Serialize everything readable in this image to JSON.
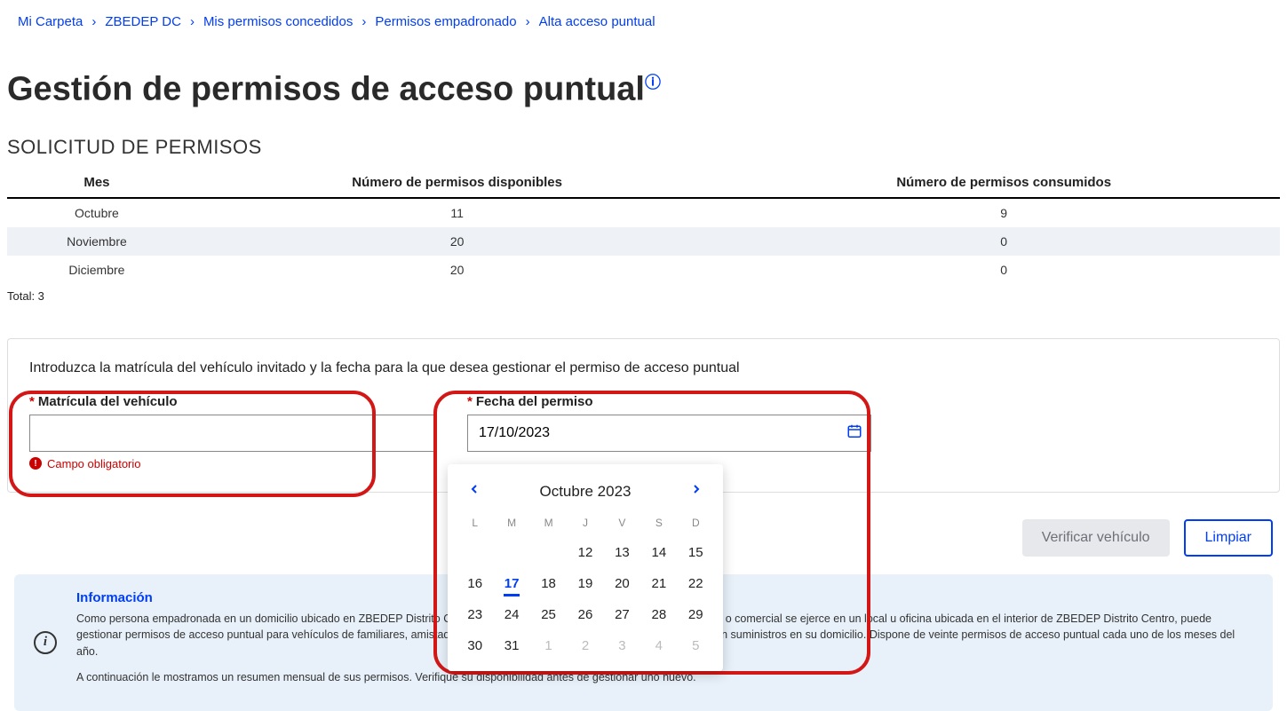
{
  "breadcrumb": [
    "Mi Carpeta",
    "ZBEDEP DC",
    "Mis permisos concedidos",
    "Permisos empadronado",
    "Alta acceso puntual"
  ],
  "title": "Gestión de permisos de acceso puntual",
  "section": "SOLICITUD DE PERMISOS",
  "table": {
    "headers": [
      "Mes",
      "Número de permisos disponibles",
      "Número de permisos consumidos"
    ],
    "rows": [
      {
        "mes": "Octubre",
        "disp": "11",
        "cons": "9"
      },
      {
        "mes": "Noviembre",
        "disp": "20",
        "cons": "0"
      },
      {
        "mes": "Diciembre",
        "disp": "20",
        "cons": "0"
      }
    ],
    "total": "Total: 3"
  },
  "form": {
    "intro": "Introduzca la matrícula del vehículo invitado y la fecha para la que desea gestionar el permiso de acceso puntual",
    "matricula_label": "Matrícula del vehículo",
    "matricula_value": "",
    "matricula_error": "Campo obligatorio",
    "fecha_label": "Fecha del permiso",
    "fecha_value": "17/10/2023"
  },
  "buttons": {
    "verify": "Verificar vehículo",
    "clear": "Limpiar"
  },
  "info": {
    "title": "Información",
    "p1": "Como persona empadronada en un domicilio ubicado en ZBEDEP Distrito Centro, o como persona física cuya actividad profesional o comercial se ejerce en un local u oficina ubicada en el interior de ZBEDEP Distrito Centro, puede gestionar permisos de acceso puntual para vehículos de familiares, amistades, profesionales que presten un servicio, o que realicen suministros en su domicilio. Dispone de veinte permisos de acceso puntual cada uno de los meses del año.",
    "p2": "A continuación le mostramos un resumen mensual de sus permisos. Verifique su disponibilidad antes de gestionar uno nuevo."
  },
  "calendar": {
    "title": "Octubre 2023",
    "dow": [
      "L",
      "M",
      "M",
      "J",
      "V",
      "S",
      "D"
    ],
    "cells": [
      {
        "n": "",
        "cls": ""
      },
      {
        "n": "",
        "cls": ""
      },
      {
        "n": "",
        "cls": ""
      },
      {
        "n": "12",
        "cls": ""
      },
      {
        "n": "13",
        "cls": ""
      },
      {
        "n": "14",
        "cls": ""
      },
      {
        "n": "15",
        "cls": ""
      },
      {
        "n": "16",
        "cls": ""
      },
      {
        "n": "17",
        "cls": "sel"
      },
      {
        "n": "18",
        "cls": ""
      },
      {
        "n": "19",
        "cls": ""
      },
      {
        "n": "20",
        "cls": ""
      },
      {
        "n": "21",
        "cls": ""
      },
      {
        "n": "22",
        "cls": ""
      },
      {
        "n": "23",
        "cls": ""
      },
      {
        "n": "24",
        "cls": ""
      },
      {
        "n": "25",
        "cls": ""
      },
      {
        "n": "26",
        "cls": ""
      },
      {
        "n": "27",
        "cls": ""
      },
      {
        "n": "28",
        "cls": ""
      },
      {
        "n": "29",
        "cls": ""
      },
      {
        "n": "30",
        "cls": ""
      },
      {
        "n": "31",
        "cls": ""
      },
      {
        "n": "1",
        "cls": "mute"
      },
      {
        "n": "2",
        "cls": "mute"
      },
      {
        "n": "3",
        "cls": "mute"
      },
      {
        "n": "4",
        "cls": "mute"
      },
      {
        "n": "5",
        "cls": "mute"
      }
    ]
  }
}
